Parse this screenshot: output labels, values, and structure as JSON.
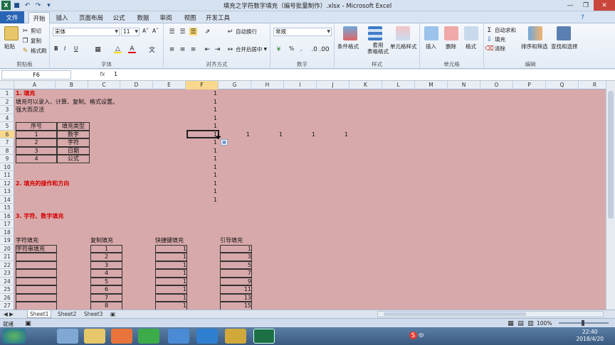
{
  "window": {
    "title": "填充之字符数字填充（编号批量制作）.xlsx - Microsoft Excel"
  },
  "tabs": [
    "文件",
    "开始",
    "插入",
    "页面布局",
    "公式",
    "数据",
    "审阅",
    "视图",
    "开发工具"
  ],
  "ribbon": {
    "clipboard": {
      "label": "剪贴板",
      "paste": "粘贴",
      "cut": "剪切",
      "copy": "复制",
      "format_painter": "格式刷"
    },
    "font": {
      "label": "字体",
      "name": "宋体",
      "size": "11",
      "bold": "B",
      "italic": "I",
      "underline": "U"
    },
    "alignment": {
      "label": "对齐方式",
      "wrap": "自动换行",
      "merge": "合并后居中"
    },
    "number": {
      "label": "数字",
      "format": "常规",
      "percent": "%",
      "comma": ","
    },
    "styles": {
      "label": "样式",
      "conditional": "条件格式",
      "table": "套用\n表格格式",
      "cell": "单元格样式"
    },
    "cells": {
      "label": "单元格",
      "insert": "插入",
      "delete": "删除",
      "format": "格式"
    },
    "editing": {
      "label": "编辑",
      "autosum": "自动求和",
      "fill": "填充",
      "clear": "清除",
      "sort": "排序和筛选",
      "find": "查找和选择"
    }
  },
  "formula_bar": {
    "name_box": "F6",
    "fx": "fx",
    "value": "1"
  },
  "columns": [
    "A",
    "B",
    "C",
    "D",
    "E",
    "F",
    "G",
    "H",
    "I",
    "J",
    "K",
    "L",
    "M",
    "N",
    "O",
    "P",
    "Q",
    "R"
  ],
  "rows": [
    "1",
    "2",
    "3",
    "4",
    "5",
    "6",
    "7",
    "8",
    "9",
    "10",
    "11",
    "12",
    "13",
    "14",
    "15",
    "16",
    "17",
    "18",
    "19",
    "20",
    "21",
    "22",
    "23",
    "24",
    "25",
    "26",
    "27"
  ],
  "cells": {
    "r1a": "1. 填充",
    "r2a": "填充可以录入、计算、复制、格式设置。",
    "r3a": "强大而灵活",
    "hdr_seq": "序号",
    "hdr_type": "填充类型",
    "types": [
      "数字",
      "字符",
      "日期",
      "公式"
    ],
    "seq": [
      "1",
      "2",
      "3",
      "4"
    ],
    "r12a": "2. 填充的操作和方向",
    "r16a": "3. 字符、数字填充",
    "t1_title": "字符填充",
    "t1_r20": "字符串填充",
    "t2_title": "复制填充",
    "t3_title": "快捷键填充",
    "t4_title": "引导填充",
    "col_f_ones": [
      "1",
      "1",
      "1",
      "1",
      "1",
      "1",
      "1",
      "1",
      "1",
      "1",
      "1",
      "1",
      "1",
      "1"
    ],
    "row6_extra": [
      "1",
      "1",
      "1",
      "1"
    ],
    "copy_fill": [
      "1",
      "2",
      "3",
      "4",
      "5",
      "6",
      "7",
      "8"
    ],
    "shortcut_fill": [
      "1",
      "1",
      "1",
      "1",
      "1",
      "1",
      "1",
      "1"
    ],
    "guide_fill": [
      "1",
      "3",
      "5",
      "7",
      "9",
      "11",
      "13",
      "15"
    ]
  },
  "sheets": [
    "Sheet1",
    "Sheet2",
    "Sheet3"
  ],
  "status": {
    "ready": "就绪",
    "zoom": "100%"
  },
  "taskbar": {
    "time": "22:40",
    "date": "2018/4/20",
    "ime": "中"
  }
}
